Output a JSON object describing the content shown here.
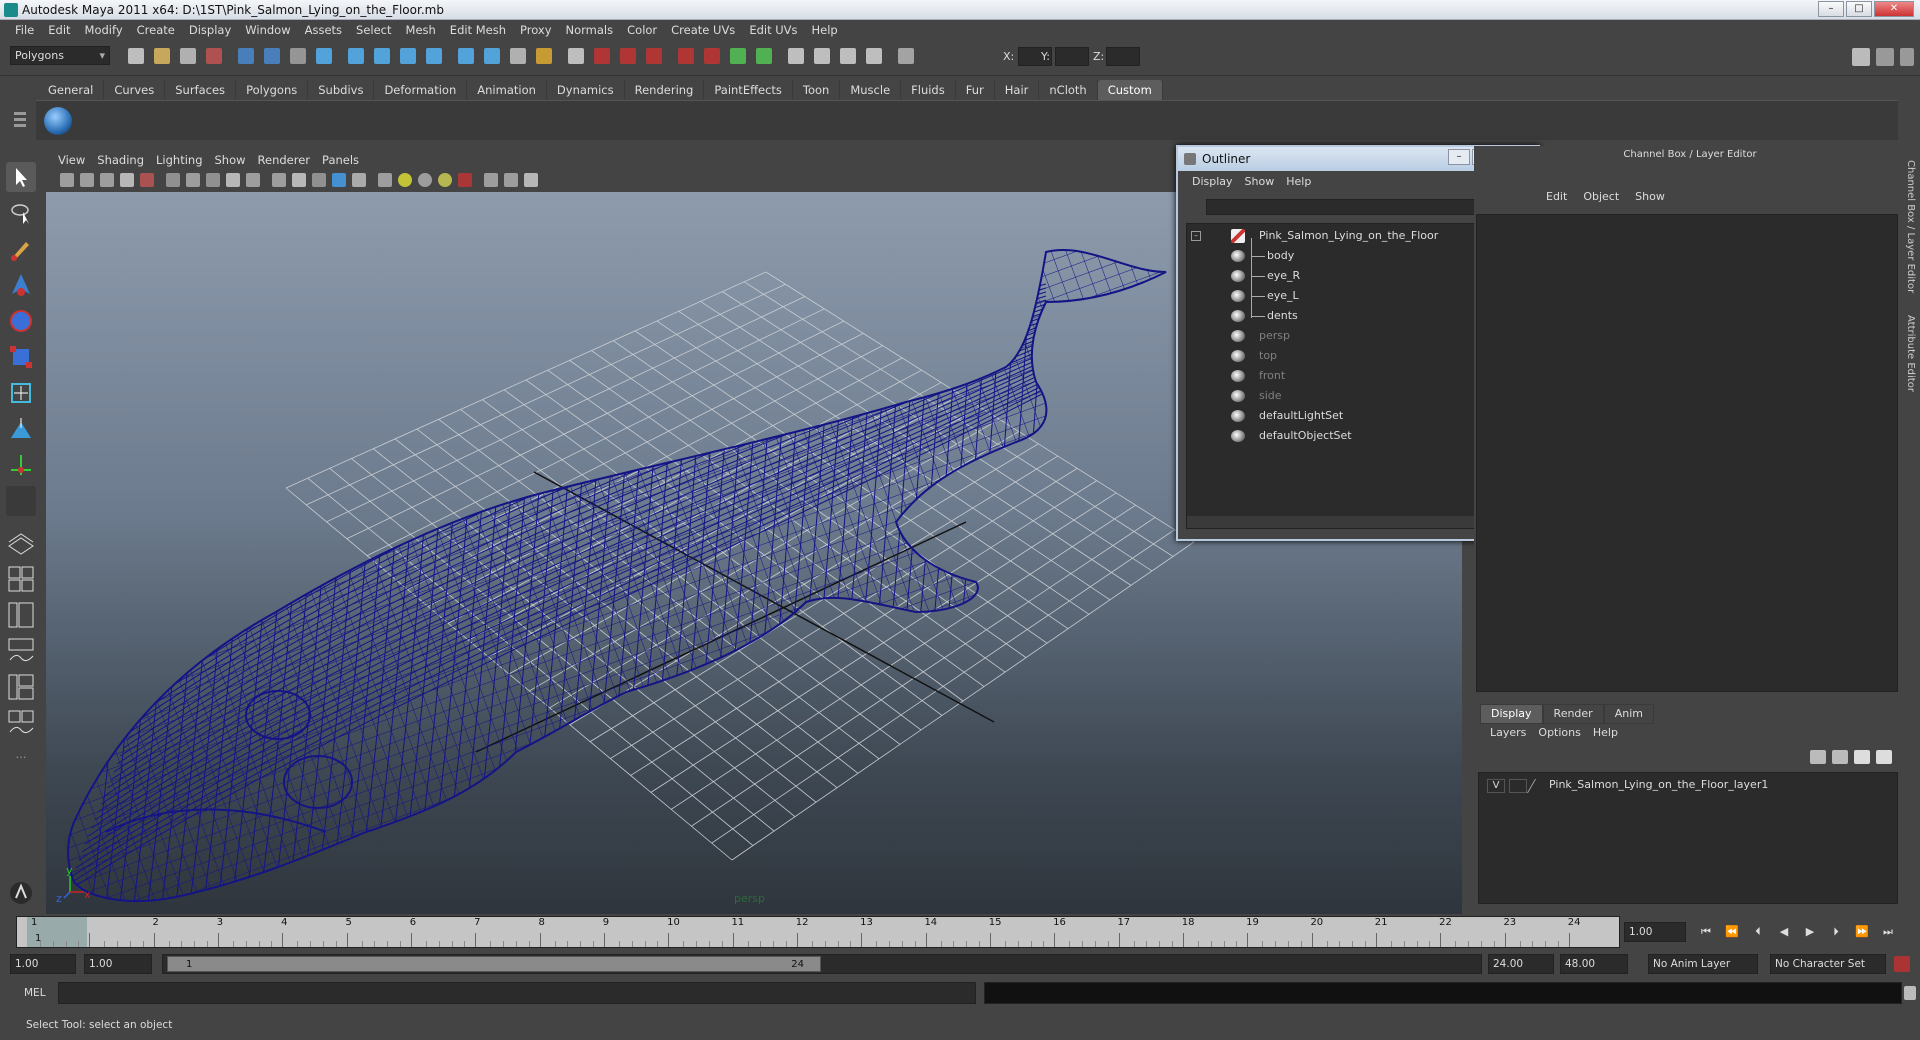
{
  "window": {
    "title": "Autodesk Maya 2011 x64: D:\\1ST\\Pink_Salmon_Lying_on_the_Floor.mb"
  },
  "menubar": [
    "File",
    "Edit",
    "Modify",
    "Create",
    "Display",
    "Window",
    "Assets",
    "Select",
    "Mesh",
    "Edit Mesh",
    "Proxy",
    "Normals",
    "Color",
    "Create UVs",
    "Edit UVs",
    "Help"
  ],
  "status_line": {
    "menu_set": "Polygons",
    "x_label": "X:",
    "y_label": "Y:",
    "z_label": "Z:"
  },
  "shelf_tabs": [
    "General",
    "Curves",
    "Surfaces",
    "Polygons",
    "Subdivs",
    "Deformation",
    "Animation",
    "Dynamics",
    "Rendering",
    "PaintEffects",
    "Toon",
    "Muscle",
    "Fluids",
    "Fur",
    "Hair",
    "nCloth",
    "Custom"
  ],
  "shelf_active": "Custom",
  "viewport": {
    "menus": [
      "View",
      "Shading",
      "Lighting",
      "Show",
      "Renderer",
      "Panels"
    ],
    "camera_label": "persp",
    "axis_y": "y",
    "axis_x": "x",
    "axis_z": "z"
  },
  "outliner": {
    "title": "Outliner",
    "menus": [
      "Display",
      "Show",
      "Help"
    ],
    "items": [
      {
        "label": "Pink_Salmon_Lying_on_the_Floor",
        "dim": false
      },
      {
        "label": "body",
        "dim": false
      },
      {
        "label": "eye_R",
        "dim": false
      },
      {
        "label": "eye_L",
        "dim": false
      },
      {
        "label": "dents",
        "dim": false
      },
      {
        "label": "persp",
        "dim": true
      },
      {
        "label": "top",
        "dim": true
      },
      {
        "label": "front",
        "dim": true
      },
      {
        "label": "side",
        "dim": true
      },
      {
        "label": "defaultLightSet",
        "dim": false
      },
      {
        "label": "defaultObjectSet",
        "dim": false
      }
    ]
  },
  "channel_box": {
    "title": "Channel Box / Layer Editor",
    "menus": [
      "Edit",
      "Object",
      "Show"
    ]
  },
  "side_tabs": [
    "Channel Box / Layer Editor",
    "Attribute Editor"
  ],
  "layer_editor": {
    "tabs": [
      "Display",
      "Render",
      "Anim"
    ],
    "active_tab": "Display",
    "menus": [
      "Layers",
      "Options",
      "Help"
    ],
    "layers": [
      {
        "visible": "V",
        "name": "Pink_Salmon_Lying_on_the_Floor_layer1"
      }
    ]
  },
  "time_slider": {
    "ticks": [
      "1",
      "2",
      "3",
      "4",
      "5",
      "6",
      "7",
      "8",
      "9",
      "10",
      "11",
      "12",
      "13",
      "14",
      "15",
      "16",
      "17",
      "18",
      "19",
      "20",
      "21",
      "22",
      "23",
      "24"
    ],
    "current_frame_marker": "1",
    "current_time": "1.00"
  },
  "range_slider": {
    "start_time": "1.00",
    "playback_start": "1.00",
    "range_start": "1",
    "range_end": "24",
    "playback_end": "24.00",
    "end_time": "48.00",
    "anim_layer": "No Anim Layer",
    "character_set": "No Character Set"
  },
  "command_line": {
    "label": "MEL"
  },
  "help_line": {
    "text": "Select Tool: select an object"
  },
  "colors": {
    "wireframe": "#1a1a8c",
    "panel": "#444444",
    "field": "#2b2b2b"
  }
}
